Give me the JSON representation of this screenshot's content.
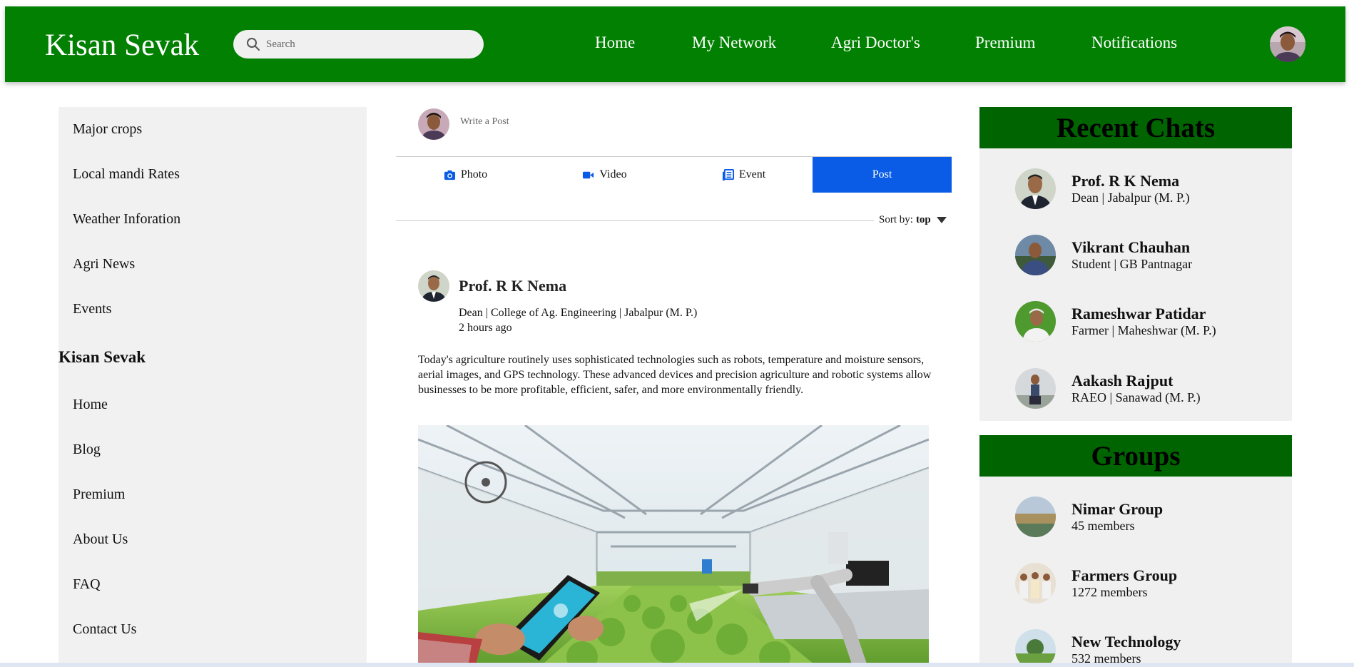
{
  "header": {
    "brand": "Kisan Sevak",
    "search_placeholder": "Search",
    "nav": [
      "Home",
      "My Network",
      "Agri Doctor's",
      "Premium",
      "Notifications"
    ]
  },
  "sidebar": {
    "items_top": [
      "Major crops",
      "Local mandi Rates",
      "Weather Inforation",
      "Agri News",
      "Events"
    ],
    "heading": "Kisan Sevak",
    "items_bottom": [
      "Home",
      "Blog",
      "Premium",
      "About Us",
      "FAQ",
      "Contact Us"
    ]
  },
  "composer": {
    "placeholder": "Write a Post",
    "tabs": [
      "Photo",
      "Video",
      "Event",
      "Post"
    ]
  },
  "sort": {
    "label": "Sort by:",
    "value": "top"
  },
  "post": {
    "author": "Prof. R K Nema",
    "title": "Dean | College of Ag. Engineering | Jabalpur (M. P.)",
    "time": "2 hours ago",
    "text": "Today's agriculture routinely uses sophisticated technologies such as robots, temperature and moisture sensors, aerial images, and GPS technology. These advanced devices and precision agriculture and robotic systems allow businesses to be more profitable, efficient, safer, and more environmentally friendly."
  },
  "recent_chats": {
    "title": "Recent Chats",
    "items": [
      {
        "name": "Prof. R K Nema",
        "sub": "Dean | Jabalpur (M. P.)"
      },
      {
        "name": "Vikrant Chauhan",
        "sub": "Student | GB Pantnagar"
      },
      {
        "name": "Rameshwar Patidar",
        "sub": "Farmer | Maheshwar (M. P.)"
      },
      {
        "name": "Aakash Rajput",
        "sub": "RAEO | Sanawad (M. P.)"
      }
    ]
  },
  "groups": {
    "title": "Groups",
    "items": [
      {
        "name": "Nimar Group",
        "sub": "45 members"
      },
      {
        "name": "Farmers Group",
        "sub": "1272 members"
      },
      {
        "name": "New Technology",
        "sub": "532 members"
      }
    ]
  },
  "colors": {
    "header_green": "#018001",
    "panel_green": "#006401",
    "post_blue": "#0a5ce6",
    "panel_bg": "#f0f0f0"
  }
}
